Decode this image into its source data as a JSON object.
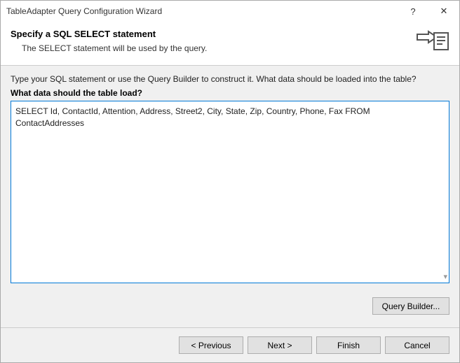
{
  "titlebar": {
    "title": "TableAdapter Query Configuration Wizard",
    "help_glyph": "?",
    "close_glyph": "✕"
  },
  "header": {
    "title": "Specify a SQL SELECT statement",
    "subtitle": "The SELECT statement will be used by the query."
  },
  "body": {
    "instruction": "Type your SQL statement or use the Query Builder to construct it. What data should be loaded into the table?",
    "label": "What data should the table load?",
    "sql": "SELECT Id, ContactId, Attention, Address, Street2, City, State, Zip, Country, Phone, Fax FROM ContactAddresses",
    "query_builder": "Query Builder..."
  },
  "footer": {
    "previous": "< Previous",
    "next": "Next >",
    "finish": "Finish",
    "cancel": "Cancel"
  }
}
